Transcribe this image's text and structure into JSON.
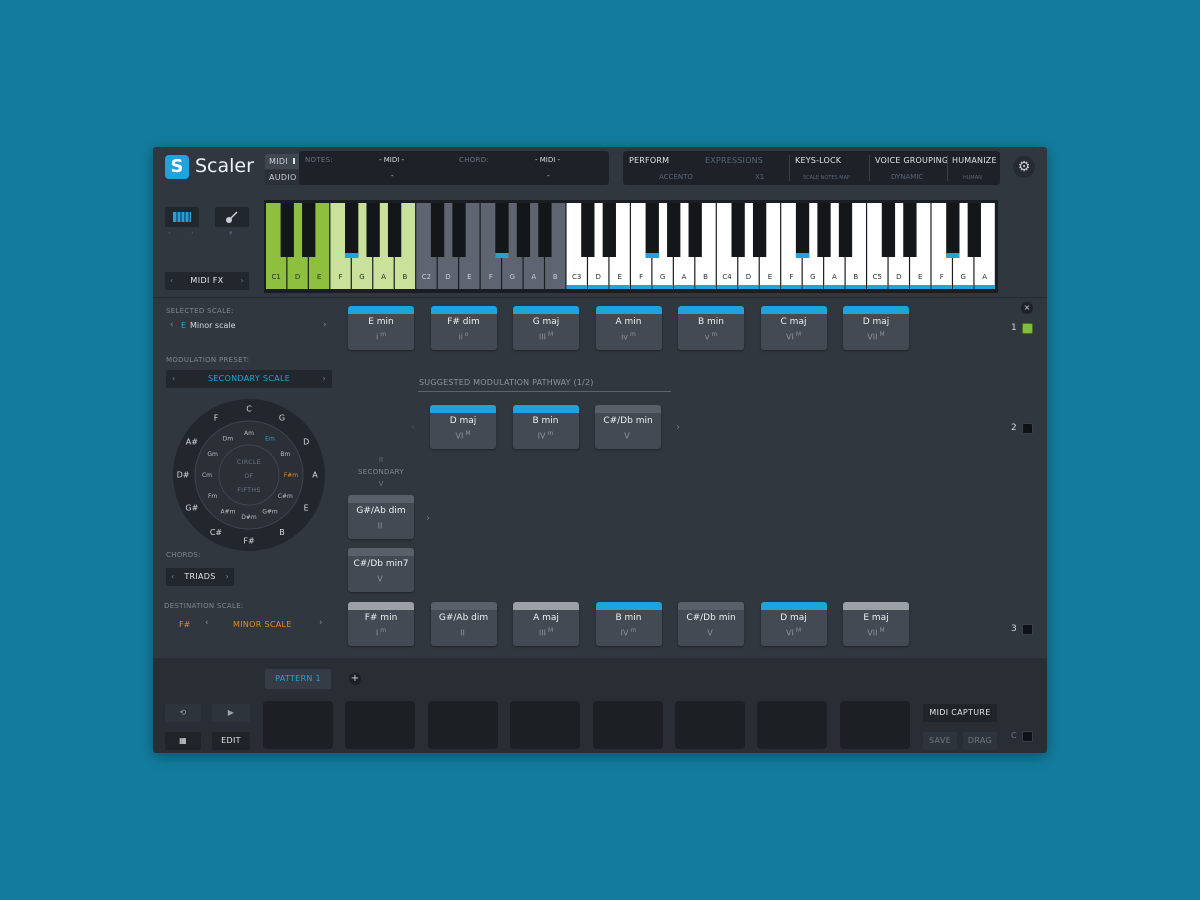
{
  "app": {
    "logo_letter": "S",
    "name": "Scaler"
  },
  "io": {
    "midi_label": "MIDI",
    "audio_label": "AUDIO",
    "notes_label": "NOTES:",
    "notes_value": "- MIDI -",
    "notes_sub": "-",
    "chord_label": "CHORD:",
    "chord_value": "- MIDI -",
    "chord_sub": "-"
  },
  "perform": {
    "perform_label": "PERFORM",
    "perform_sub": "ACCENTO",
    "expressions_label": "EXPRESSIONS",
    "expressions_sub": "X1",
    "keyslock_label": "KEYS-LOCK",
    "keyslock_sub": "SCALE NOTES MAP",
    "voice_label": "VOICE GROUPING",
    "voice_sub": "DYNAMIC",
    "humanize_label": "HUMANIZE",
    "humanize_sub": "HUMAN"
  },
  "left": {
    "midifx_label": "MIDI FX",
    "selected_scale_label": "SELECTED SCALE:",
    "selected_scale_root": "E",
    "selected_scale_name": "Minor scale",
    "modulation_preset_label": "MODULATION PRESET:",
    "modulation_preset_value": "SECONDARY SCALE",
    "chords_label": "CHORDS:",
    "chords_value": "TRIADS",
    "destination_label": "DESTINATION SCALE:",
    "destination_root": "F#",
    "destination_name": "MINOR SCALE"
  },
  "circle": {
    "center_lines": [
      "CIRCLE",
      "OF",
      "FIFTHS"
    ],
    "outer": [
      "C",
      "G",
      "D",
      "A",
      "E",
      "B",
      "F#",
      "C#",
      "G#",
      "D#",
      "A#",
      "F"
    ],
    "inner": [
      "Am",
      "Em",
      "Bm",
      "F#m",
      "C#m",
      "G#m",
      "D#m",
      "A#m",
      "Fm",
      "Cm",
      "Gm",
      "Dm"
    ],
    "highlight_inner_blue": "Em",
    "highlight_inner_orange": "F#m"
  },
  "keyboard": {
    "labels": [
      "C1",
      "D",
      "E",
      "F",
      "G",
      "A",
      "B",
      "C2",
      "D",
      "E",
      "F",
      "G",
      "A",
      "B",
      "C3",
      "D",
      "E",
      "F",
      "G",
      "A",
      "B",
      "C4",
      "D",
      "E",
      "F",
      "G",
      "A",
      "B",
      "C5",
      "D",
      "E",
      "F",
      "G",
      "A"
    ]
  },
  "pathway": {
    "title": "SUGGESTED MODULATION PATHWAY (1/2)",
    "secondary_top": "II",
    "secondary_label": "SECONDARY",
    "secondary_bottom": "V"
  },
  "rows": {
    "row1": [
      {
        "name": "E min",
        "degree": "i",
        "sup": "m",
        "bar": "blue"
      },
      {
        "name": "F# dim",
        "degree": "ii",
        "sup": "o",
        "bar": "blue"
      },
      {
        "name": "G maj",
        "degree": "III",
        "sup": "M",
        "bar": "blue"
      },
      {
        "name": "A min",
        "degree": "iv",
        "sup": "m",
        "bar": "blue"
      },
      {
        "name": "B min",
        "degree": "v",
        "sup": "m",
        "bar": "blue"
      },
      {
        "name": "C maj",
        "degree": "VI",
        "sup": "M",
        "bar": "blue"
      },
      {
        "name": "D maj",
        "degree": "VII",
        "sup": "M",
        "bar": "blue"
      }
    ],
    "row2": [
      {
        "name": "D maj",
        "degree": "VI",
        "sup": "M",
        "bar": "blue"
      },
      {
        "name": "B min",
        "degree": "IV",
        "sup": "m",
        "bar": "blue"
      },
      {
        "name": "C#/Db min",
        "degree": "V",
        "sup": "",
        "bar": "grey"
      }
    ],
    "secondary": [
      {
        "name": "G#/Ab dim",
        "degree": "II",
        "sup": "",
        "bar": "grey"
      },
      {
        "name": "C#/Db min7",
        "degree": "V",
        "sup": "",
        "bar": "grey"
      }
    ],
    "row3": [
      {
        "name": "F# min",
        "degree": "I",
        "sup": "m",
        "bar": "light"
      },
      {
        "name": "G#/Ab dim",
        "degree": "II",
        "sup": "",
        "bar": "grey"
      },
      {
        "name": "A maj",
        "degree": "III",
        "sup": "M",
        "bar": "light"
      },
      {
        "name": "B min",
        "degree": "IV",
        "sup": "m",
        "bar": "blue"
      },
      {
        "name": "C#/Db min",
        "degree": "V",
        "sup": "",
        "bar": "grey"
      },
      {
        "name": "D maj",
        "degree": "VI",
        "sup": "M",
        "bar": "blue"
      },
      {
        "name": "E maj",
        "degree": "VII",
        "sup": "M",
        "bar": "light"
      }
    ],
    "row_numbers": [
      "1",
      "2",
      "3"
    ]
  },
  "bottom": {
    "pattern_label": "PATTERN 1",
    "edit_label": "EDIT",
    "midi_capture_label": "MIDI CAPTURE",
    "save_label": "SAVE",
    "drag_label": "DRAG",
    "c_label": "C",
    "pad_count": 8
  },
  "colors": {
    "accent_blue": "#1fa3dc",
    "orange": "#e48a23",
    "green_key": "#8fbf3f",
    "light_green_key": "#c9e19a",
    "background": "#137c9e"
  }
}
